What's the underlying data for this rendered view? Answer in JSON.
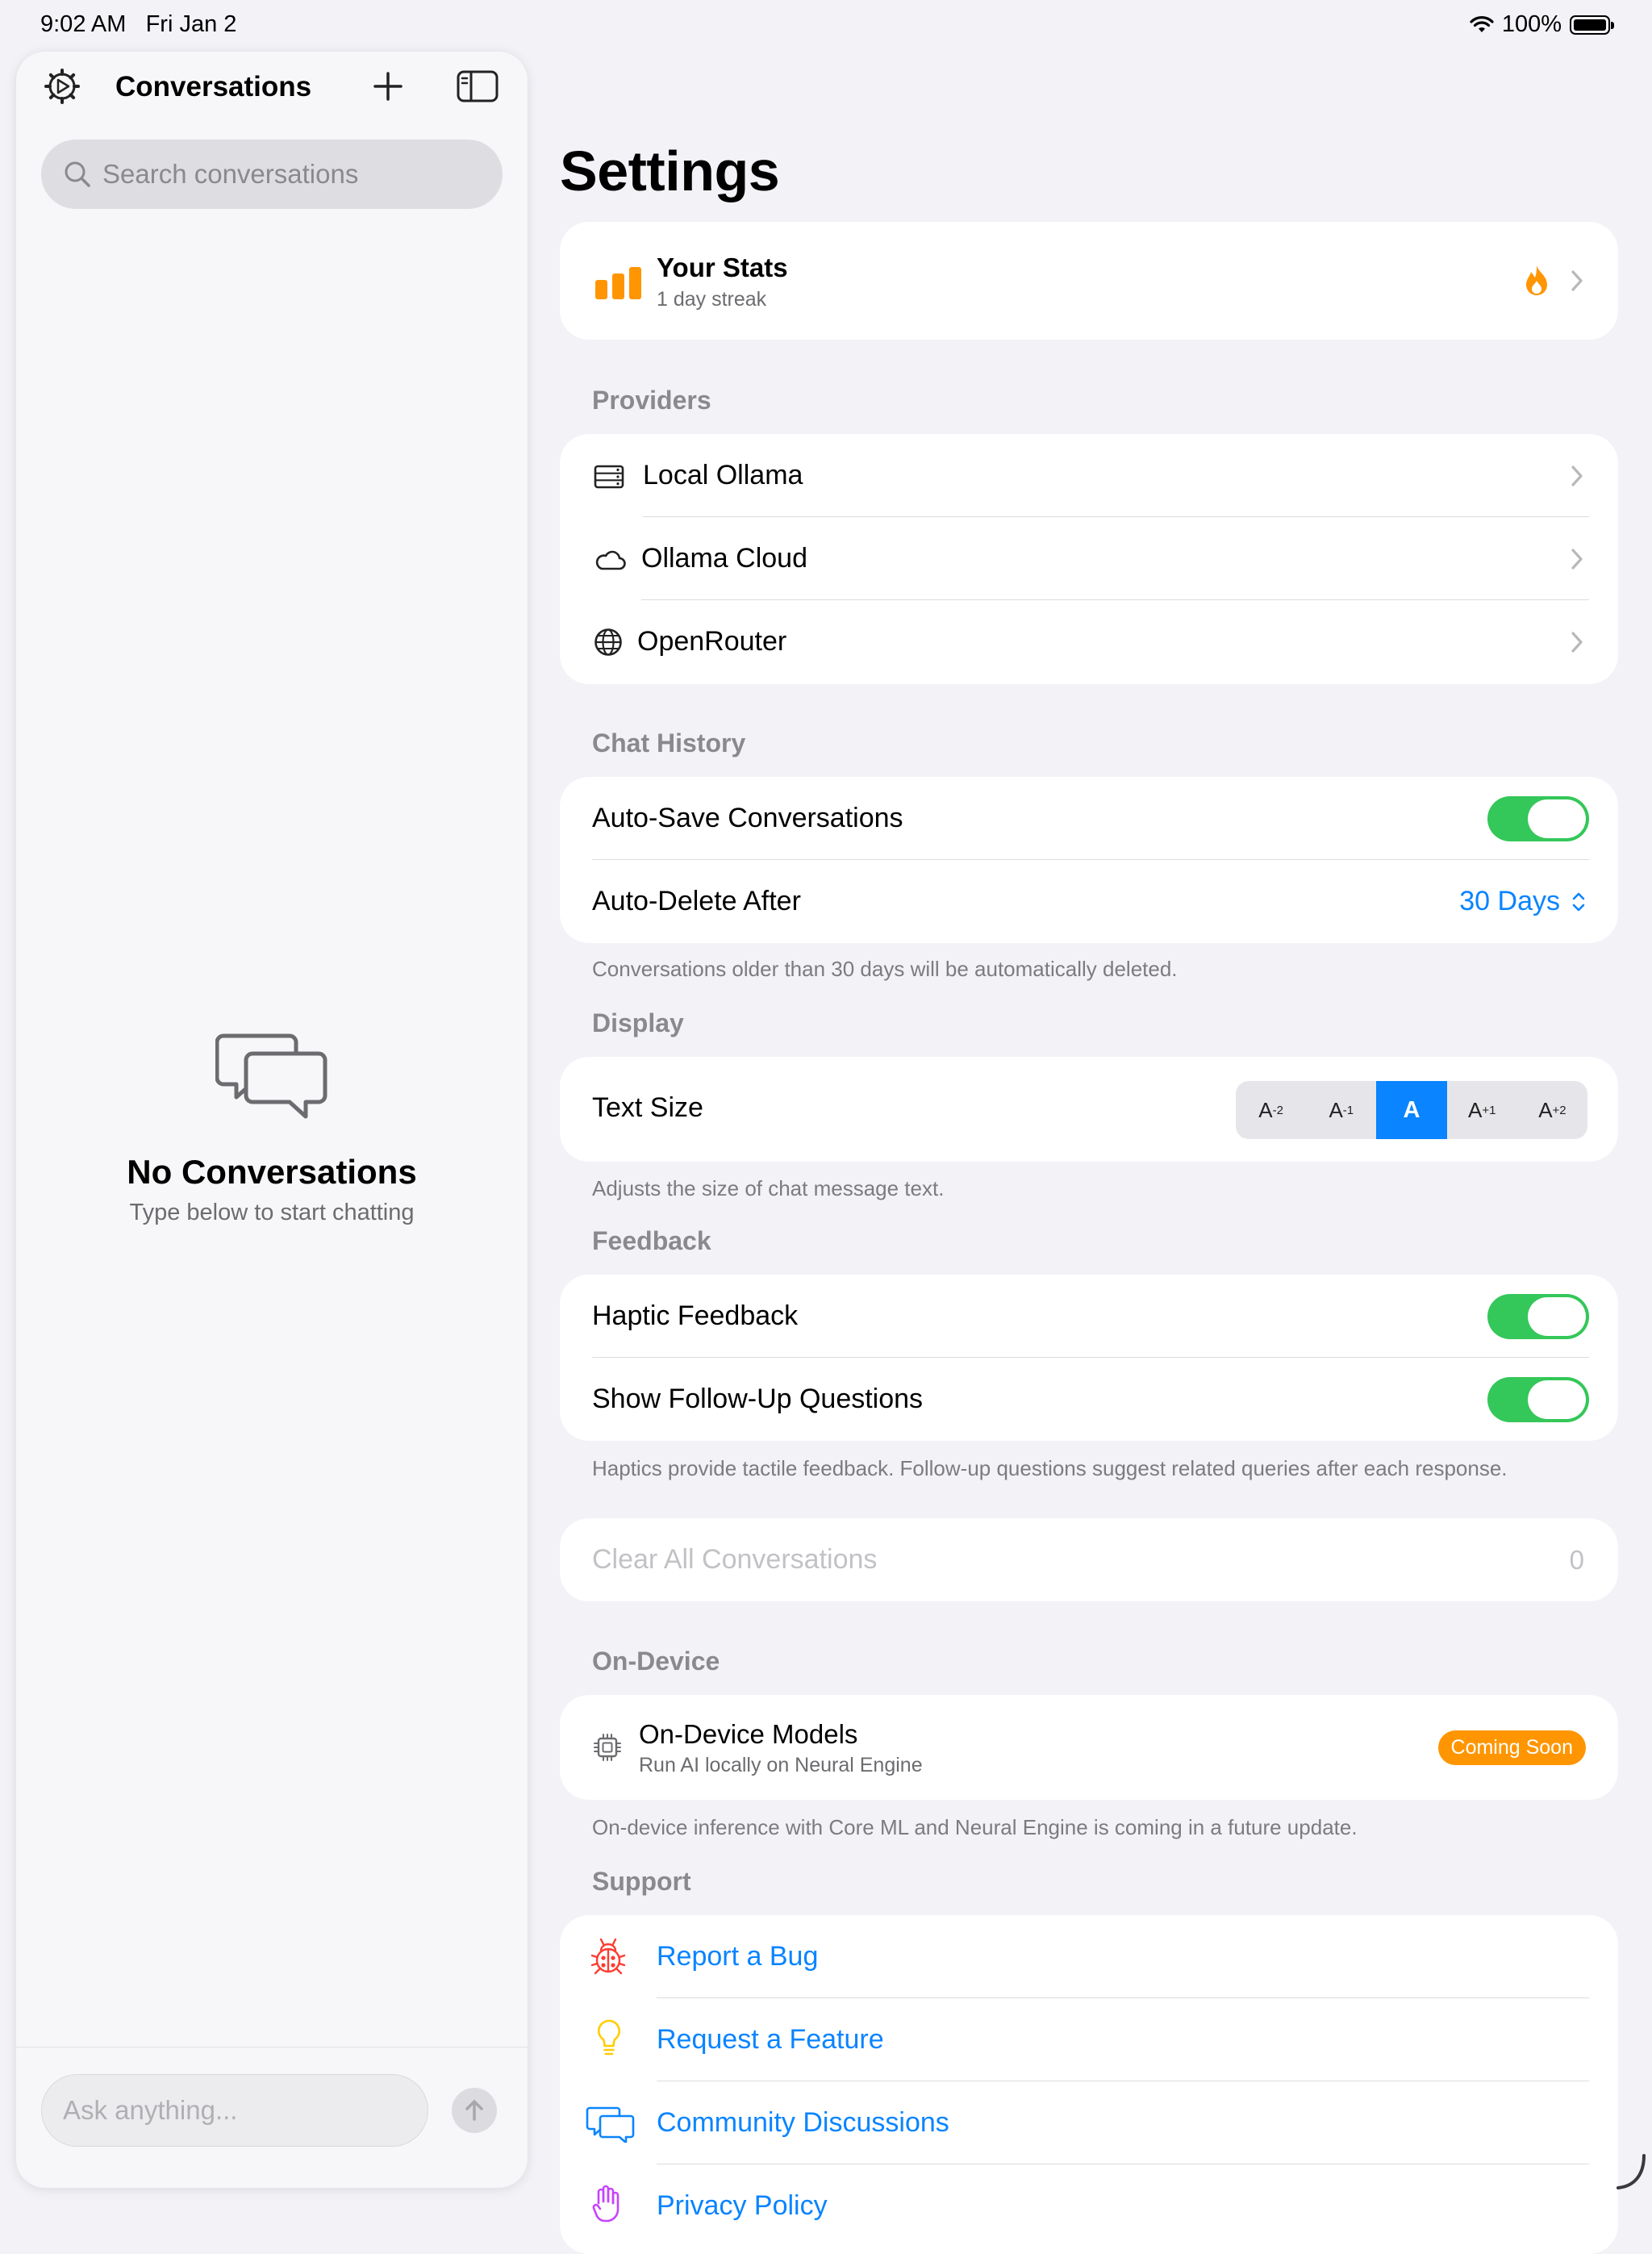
{
  "status_bar": {
    "time": "9:02 AM",
    "date": "Fri Jan 2",
    "battery": "100%"
  },
  "sidebar": {
    "title": "Conversations",
    "search_placeholder": "Search conversations",
    "empty_title": "No Conversations",
    "empty_subtitle": "Type below to start chatting",
    "ask_placeholder": "Ask anything..."
  },
  "settings": {
    "title": "Settings",
    "stats": {
      "title": "Your Stats",
      "subtitle": "1 day streak"
    },
    "providers": {
      "header": "Providers",
      "items": [
        {
          "label": "Local Ollama",
          "icon": "server-icon"
        },
        {
          "label": "Ollama Cloud",
          "icon": "cloud-icon"
        },
        {
          "label": "OpenRouter",
          "icon": "globe-icon"
        }
      ]
    },
    "chat_history": {
      "header": "Chat History",
      "auto_save_label": "Auto-Save Conversations",
      "auto_save_on": true,
      "auto_delete_label": "Auto-Delete After",
      "auto_delete_value": "30 Days",
      "footnote": "Conversations older than 30 days will be automatically deleted."
    },
    "display": {
      "header": "Display",
      "text_size_label": "Text Size",
      "sizes": [
        "A",
        "A",
        "A",
        "A",
        "A"
      ],
      "size_sups": [
        "-2",
        "-1",
        "",
        "+1",
        "+2"
      ],
      "selected_index": 2,
      "footnote": "Adjusts the size of chat message text."
    },
    "feedback": {
      "header": "Feedback",
      "haptic_label": "Haptic Feedback",
      "haptic_on": true,
      "followup_label": "Show Follow-Up Questions",
      "followup_on": true,
      "footnote": "Haptics provide tactile feedback. Follow-up questions suggest related queries after each response."
    },
    "clear": {
      "label": "Clear All Conversations",
      "count": "0"
    },
    "on_device": {
      "header": "On-Device",
      "title": "On-Device Models",
      "subtitle": "Run AI locally on Neural Engine",
      "badge": "Coming Soon",
      "footnote": "On-device inference with Core ML and Neural Engine is coming in a future update."
    },
    "support": {
      "header": "Support",
      "items": [
        {
          "label": "Report a Bug",
          "icon": "ladybug-icon"
        },
        {
          "label": "Request a Feature",
          "icon": "lightbulb-icon"
        },
        {
          "label": "Community Discussions",
          "icon": "chat-bubbles-icon"
        },
        {
          "label": "Privacy Policy",
          "icon": "hand-icon"
        }
      ]
    }
  },
  "colors": {
    "accent": "#0a84ff",
    "toggle_on": "#34c759",
    "orange": "#ff9500",
    "background": "#f2f2f7"
  }
}
